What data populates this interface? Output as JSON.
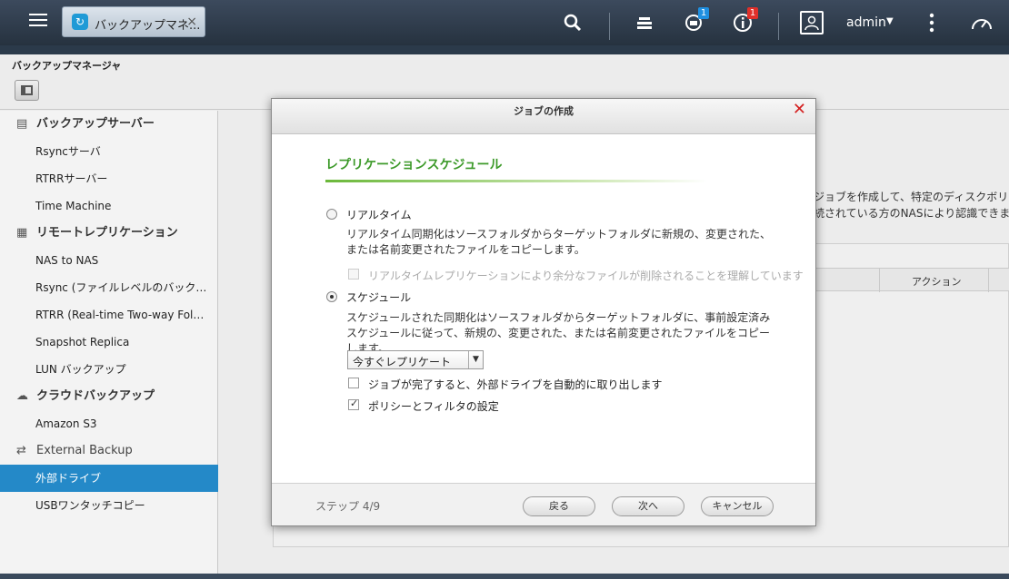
{
  "topbar": {
    "tab_title": "バックアップマネ...",
    "tab_close": "×",
    "notif_badge": "1",
    "info_badge": "1",
    "user_name": "admin"
  },
  "window": {
    "title": "バックアップマネージャ"
  },
  "sidebar": {
    "groups": [
      {
        "label": "バックアップサーバー",
        "icon": "server-icon"
      },
      {
        "label": "リモートレプリケーション",
        "icon": "replication-icon"
      },
      {
        "label": "クラウドバックアップ",
        "icon": "cloud-icon"
      },
      {
        "label": "External Backup",
        "icon": "sync-icon"
      }
    ],
    "items": [
      {
        "label": "Rsyncサーバ"
      },
      {
        "label": "RTRRサーバー"
      },
      {
        "label": "Time Machine"
      },
      {
        "label": "NAS to NAS"
      },
      {
        "label": "Rsync (ファイルレベルのバックアップ)"
      },
      {
        "label": "RTRR (Real-time Two-way Folder Replication)"
      },
      {
        "label": "Snapshot Replica"
      },
      {
        "label": "LUN バックアップ"
      },
      {
        "label": "Amazon S3"
      },
      {
        "label": "外部ドライブ"
      },
      {
        "label": "USBワンタッチコピー"
      }
    ],
    "active_item": "外部ドライブ"
  },
  "background": {
    "text_line1": "ジョブを作成して、特定のディスクボリュー",
    "text_line2": "続されている方のNASにより認識できます。",
    "col_action": "アクション"
  },
  "modal": {
    "title": "ジョブの作成",
    "close": "✕",
    "section_title": "レプリケーションスケジュール",
    "option_realtime": {
      "label": "リアルタイム",
      "desc": "リアルタイム同期化はソースフォルダからターゲットフォルダに新規の、変更された、または名前変更されたファイルをコピーします。",
      "checkbox_label": "リアルタイムレプリケーションにより余分なファイルが削除されることを理解しています",
      "selected": false
    },
    "option_schedule": {
      "label": "スケジュール",
      "desc": "スケジュールされた同期化はソースフォルダからターゲットフォルダに、事前設定済みスケジュールに従って、新規の、変更された、または名前変更されたファイルをコピーします。",
      "selected": true
    },
    "schedule_select": {
      "value": "今すぐレプリケート"
    },
    "checkbox_eject": {
      "label": "ジョブが完了すると、外部ドライブを自動的に取り出します",
      "checked": false
    },
    "checkbox_policy": {
      "label": "ポリシーとフィルタの設定",
      "checked": true
    },
    "footer": {
      "step": "ステップ 4/9",
      "back": "戻る",
      "next": "次へ",
      "cancel": "キャンセル"
    }
  }
}
